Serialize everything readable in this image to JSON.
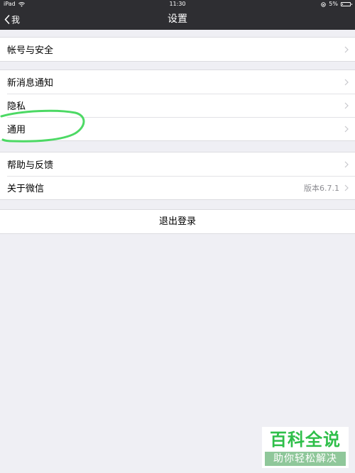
{
  "status_bar": {
    "carrier": "iPad",
    "time": "11:30",
    "battery": "5%",
    "wifi_icon": "wifi-icon",
    "lock_icon": "rotation-lock-icon"
  },
  "nav": {
    "back_label": "我",
    "title": "设置"
  },
  "groups": [
    {
      "items": [
        {
          "label": "帐号与安全",
          "value": ""
        }
      ]
    },
    {
      "items": [
        {
          "label": "新消息通知",
          "value": ""
        },
        {
          "label": "隐私",
          "value": ""
        },
        {
          "label": "通用",
          "value": ""
        }
      ]
    },
    {
      "items": [
        {
          "label": "帮助与反馈",
          "value": ""
        },
        {
          "label": "关于微信",
          "value": "版本6.7.1"
        }
      ]
    }
  ],
  "logout": {
    "label": "退出登录"
  },
  "annotation": {
    "color": "#4cd964"
  },
  "watermark": {
    "title": "百科全说",
    "subtitle": "助你轻松解决"
  }
}
